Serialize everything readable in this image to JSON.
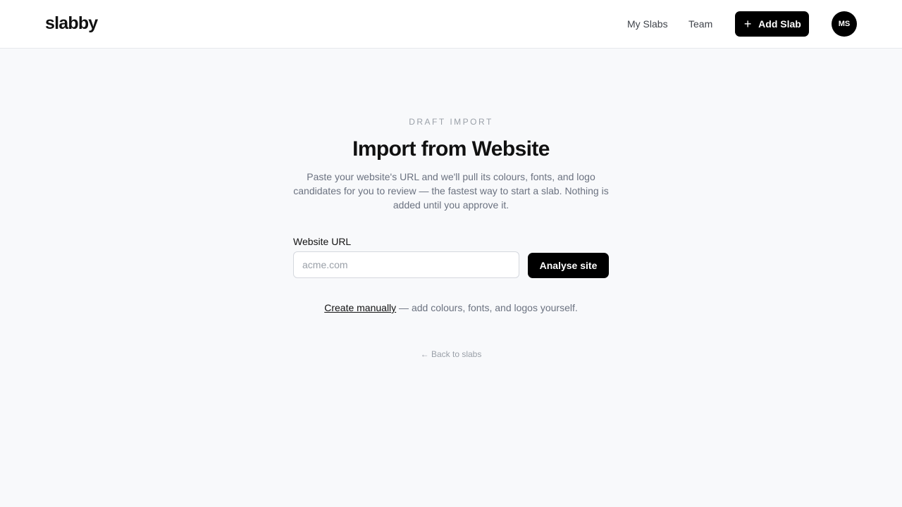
{
  "app": {
    "logo": "slabby"
  },
  "header": {
    "nav": [
      {
        "label": "My Slabs"
      },
      {
        "label": "Team"
      }
    ],
    "add_button": {
      "icon": "plus-icon",
      "label": "Add Slab"
    },
    "avatar_initials": "MS"
  },
  "main": {
    "eyebrow": "DRAFT IMPORT",
    "title": "Import from Website",
    "subtitle": "Paste your website's URL and we'll pull its colours, fonts, and logo candidates for you to review — the fastest way to start a slab. Nothing is added until you approve it.",
    "url_field": {
      "label": "Website URL",
      "value": "",
      "placeholder": "acme.com"
    },
    "analyse_button": "Analyse site",
    "manual": {
      "link": "Create manually",
      "rest": " — add colours, fonts, and logos yourself."
    },
    "back_link": "← Back to slabs"
  },
  "colors": {
    "background": "#f8f9fb",
    "header_bg": "#ffffff",
    "primary": "#000000",
    "muted_text": "#6b7280",
    "faint_text": "#9aa0a8"
  }
}
